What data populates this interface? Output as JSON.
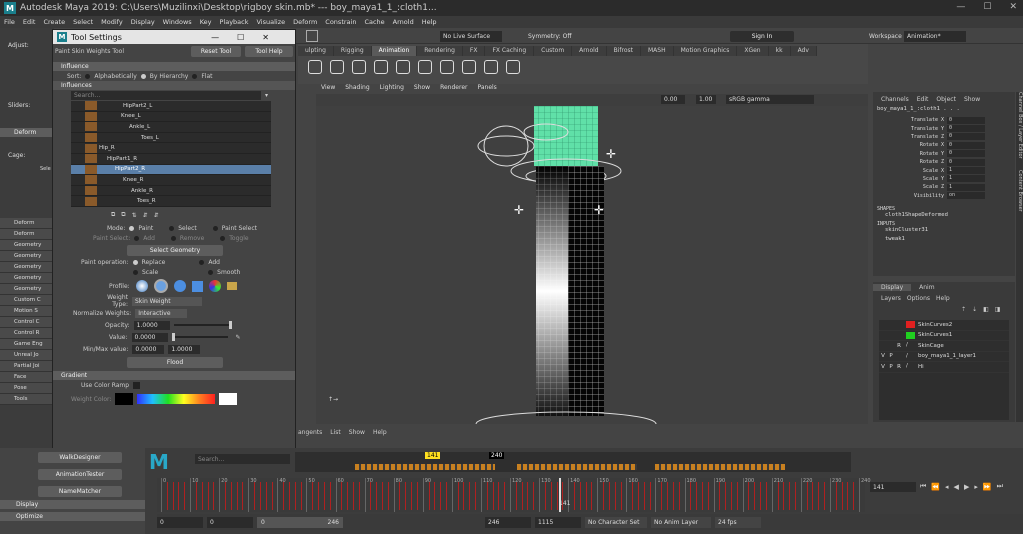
{
  "window": {
    "title": "Autodesk Maya 2019: C:\\Users\\Muzilinxi\\Desktop\\rigboy skin.mb*  ---  boy_maya1_1_:cloth1...",
    "controls": [
      "—",
      "☐",
      "✕"
    ]
  },
  "menubar": [
    "File",
    "Edit",
    "Create",
    "Select",
    "Modify",
    "Display",
    "Windows",
    "Key",
    "Playback",
    "Visualize",
    "Deform",
    "Constrain",
    "Cache",
    "Arnold",
    "Help"
  ],
  "statusline": {
    "live_surface": "No Live Surface",
    "symmetry": "Symmetry: Off",
    "sign_in": "Sign In",
    "workspace_label": "Workspace :",
    "workspace_value": "Animation*"
  },
  "shelf_tabs": [
    "ulpting",
    "Rigging",
    "Animation",
    "Rendering",
    "FX",
    "FX Caching",
    "Custom",
    "Arnold",
    "Bifrost",
    "MASH",
    "Motion Graphics",
    "XGen",
    "kk",
    "Adv"
  ],
  "left_strip": {
    "adjust": "Adjust:",
    "sliders": "Sliders:",
    "cage": "Cage:",
    "select_abbrev": "Sele",
    "deform": "Deform",
    "items": [
      "Deform",
      "Deform",
      "Geometry",
      "Geometry",
      "Geometry",
      "Geometry",
      "Geometry",
      "Custom C",
      "Motion S",
      "Control C",
      "Control R",
      "Game Eng",
      "Unreal Jo",
      "Partial Joi",
      "Face",
      "Pose",
      "Tools"
    ],
    "bottom_items": [
      "Display",
      "Optimize"
    ]
  },
  "tool_settings": {
    "title": "Tool Settings",
    "tool_name": "Paint Skin Weights Tool",
    "reset": "Reset Tool",
    "help": "Tool Help",
    "influence_section": "Influence",
    "sort_label": "Sort:",
    "sort_options": [
      "Alphabetically",
      "By Hierarchy",
      "Flat"
    ],
    "influences_label": "Influences",
    "search_placeholder": "Search...",
    "influence_items": [
      "HipPart2_L",
      "Knee_L",
      "Ankle_L",
      "Toes_L",
      "Hip_R",
      "HipPart1_R",
      "HipPart2_R",
      "Knee_R",
      "Ankle_R",
      "Toes_R"
    ],
    "mode_label": "Mode:",
    "modes": [
      "Paint",
      "Select",
      "Paint Select"
    ],
    "paint_select_label": "Paint Select:",
    "paint_select_opts": [
      "Add",
      "Remove",
      "Toggle"
    ],
    "select_geometry": "Select Geometry",
    "paint_operation_label": "Paint operation:",
    "paint_ops": [
      "Replace",
      "Add",
      "Scale",
      "Smooth"
    ],
    "profile_label": "Profile:",
    "weight_type_label": "Weight Type:",
    "weight_type": "Skin Weight",
    "normalize_label": "Normalize Weights:",
    "normalize": "Interactive",
    "opacity_label": "Opacity:",
    "opacity": "1.0000",
    "value_label": "Value:",
    "value": "0.0000",
    "minmax_label": "Min/Max value:",
    "min": "0.0000",
    "max": "1.0000",
    "flood": "Flood",
    "gradient_section": "Gradient",
    "use_color_ramp": "Use Color Ramp",
    "weight_color": "Weight Color:"
  },
  "viewport": {
    "menu": [
      "View",
      "Shading",
      "Lighting",
      "Show",
      "Renderer",
      "Panels"
    ],
    "field1": "0.00",
    "field2": "1.00",
    "colorspace": "sRGB gamma"
  },
  "channel_box": {
    "menu": [
      "Channels",
      "Edit",
      "Object",
      "Show"
    ],
    "object": "boy_maya1_1_:cloth1 . . .",
    "attrs": [
      {
        "name": "Translate X",
        "value": "0"
      },
      {
        "name": "Translate Y",
        "value": "0"
      },
      {
        "name": "Translate Z",
        "value": "0"
      },
      {
        "name": "Rotate X",
        "value": "0"
      },
      {
        "name": "Rotate Y",
        "value": "0"
      },
      {
        "name": "Rotate Z",
        "value": "0"
      },
      {
        "name": "Scale X",
        "value": "1"
      },
      {
        "name": "Scale Y",
        "value": "1"
      },
      {
        "name": "Scale Z",
        "value": "1"
      },
      {
        "name": "Visibility",
        "value": "on"
      }
    ],
    "shapes_label": "SHAPES",
    "shape": "cloth1ShapeDeformed",
    "inputs_label": "INPUTS",
    "inputs": [
      "skinCluster31",
      "tweak1"
    ],
    "side_tabs": [
      "Channel Box / Layer Editor",
      "Content Browser"
    ]
  },
  "layer_editor": {
    "tabs": [
      "Display",
      "Anim"
    ],
    "menu": [
      "Layers",
      "Options",
      "Help"
    ],
    "layers": [
      {
        "v": "",
        "p": "",
        "r": "",
        "color": "#e02020",
        "name": "SkinCurves2"
      },
      {
        "v": "",
        "p": "",
        "r": "",
        "color": "#20d020",
        "name": "SkinCurves1"
      },
      {
        "v": "",
        "p": "",
        "r": "R",
        "color": "",
        "name": "SkinCage"
      },
      {
        "v": "V",
        "p": "P",
        "r": "",
        "color": "",
        "name": "boy_maya1_1_layer1"
      },
      {
        "v": "V",
        "p": "P",
        "r": "R",
        "color": "",
        "name": "Hi"
      }
    ]
  },
  "graph_menu": [
    "angents",
    "List",
    "Show",
    "Help"
  ],
  "bottom_buttons": [
    "WalkDesigner",
    "AnimationTester",
    "NameMatcher"
  ],
  "search2": "Search...",
  "timeline": {
    "current_frame": "141",
    "marker_top": "141",
    "mark_240": "240",
    "frame_field": "141",
    "ticks": [
      "0",
      "10",
      "20",
      "30",
      "40",
      "50",
      "60",
      "70",
      "80",
      "90",
      "100",
      "110",
      "120",
      "130",
      "140",
      "150",
      "160",
      "170",
      "180",
      "190",
      "200",
      "210",
      "220",
      "230",
      "240"
    ]
  },
  "range": {
    "start": "0",
    "start2": "0",
    "slider_left": "0",
    "slider_right": "246",
    "end": "246",
    "end2": "1115",
    "char_set": "No Character Set",
    "anim_layer": "No Anim Layer",
    "fps": "24 fps"
  }
}
